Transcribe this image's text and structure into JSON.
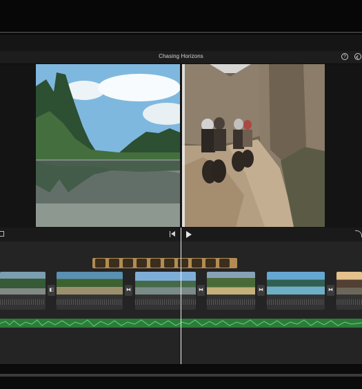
{
  "window": {
    "title": "Chasing Horizons"
  },
  "toolbar": {
    "help_icon": "help-icon",
    "share_icon": "share-icon",
    "help_text": "?"
  },
  "viewer": {
    "left_preview": "karst-lake-preview",
    "right_preview": "motorcycle-street-preview"
  },
  "controls": {
    "icons": [
      "crop-icon",
      "skip-back-icon",
      "play-icon",
      "undo-icon"
    ]
  },
  "timeline": {
    "overlay_clip": "photo-overlay-strip",
    "clips": [
      "clip-1",
      "clip-2",
      "clip-3",
      "clip-4",
      "clip-5",
      "clip-6"
    ],
    "transitions": [
      "transition-1",
      "transition-2",
      "transition-3",
      "transition-4",
      "transition-5"
    ],
    "audio_track": "music-track"
  },
  "colors": {
    "accent_audio": "#2e7a3b",
    "overlay_strip": "#b28c54",
    "background": "#151515"
  }
}
